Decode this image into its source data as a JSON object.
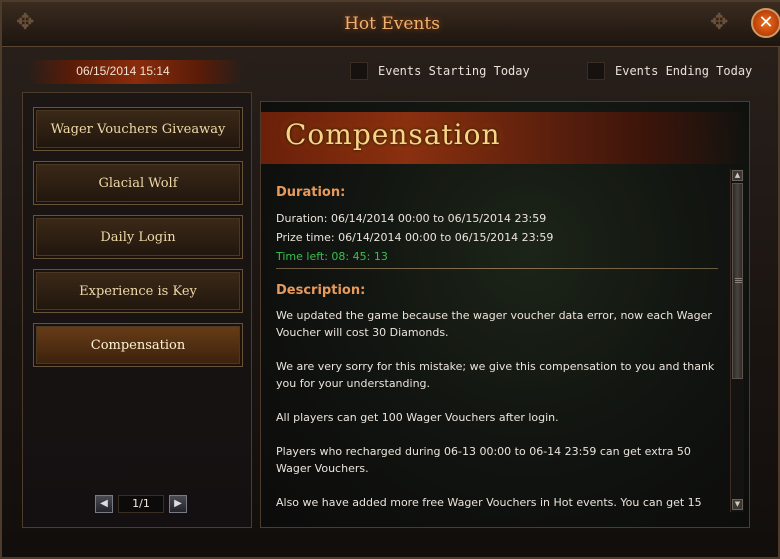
{
  "window": {
    "title": "Hot Events",
    "close_symbol": "✕"
  },
  "header": {
    "datetime": "06/15/2014 15:14",
    "filters": [
      {
        "label": "Events Starting Today",
        "checked": false
      },
      {
        "label": "Events Ending Today",
        "checked": false
      }
    ]
  },
  "sidebar": {
    "items": [
      {
        "label": "Wager Vouchers Giveaway",
        "active": false
      },
      {
        "label": "Glacial Wolf",
        "active": false
      },
      {
        "label": "Daily Login",
        "active": false
      },
      {
        "label": "Experience is Key",
        "active": false
      },
      {
        "label": "Compensation",
        "active": true
      }
    ],
    "pager": {
      "prev": "◀",
      "page": "1/1",
      "next": "▶"
    }
  },
  "event": {
    "title": "Compensation",
    "duration_heading": "Duration:",
    "duration": "Duration: 06/14/2014 00:00 to 06/15/2014 23:59",
    "prize_time": "Prize time: 06/14/2014 00:00 to 06/15/2014 23:59",
    "time_left": "Time left: 08: 45: 13",
    "description_heading": "Description:",
    "paragraphs": [
      "We updated the game because the wager voucher data error, now each Wager Voucher will cost 30 Diamonds.",
      "We are very sorry for this mistake; we give this compensation to you and thank you for your understanding.",
      "All players can get 100 Wager Vouchers after login.",
      "Players who recharged during 06-13 00:00 to 06-14 23:59 can get extra 50 Wager Vouchers.",
      "Also we have added more free Wager Vouchers in Hot events. You can get 15"
    ]
  },
  "scrollbar": {
    "up": "▲",
    "down": "▼"
  },
  "colors": {
    "accent": "#f0b070",
    "heading": "#e89a5a",
    "time_left": "#38c050"
  }
}
